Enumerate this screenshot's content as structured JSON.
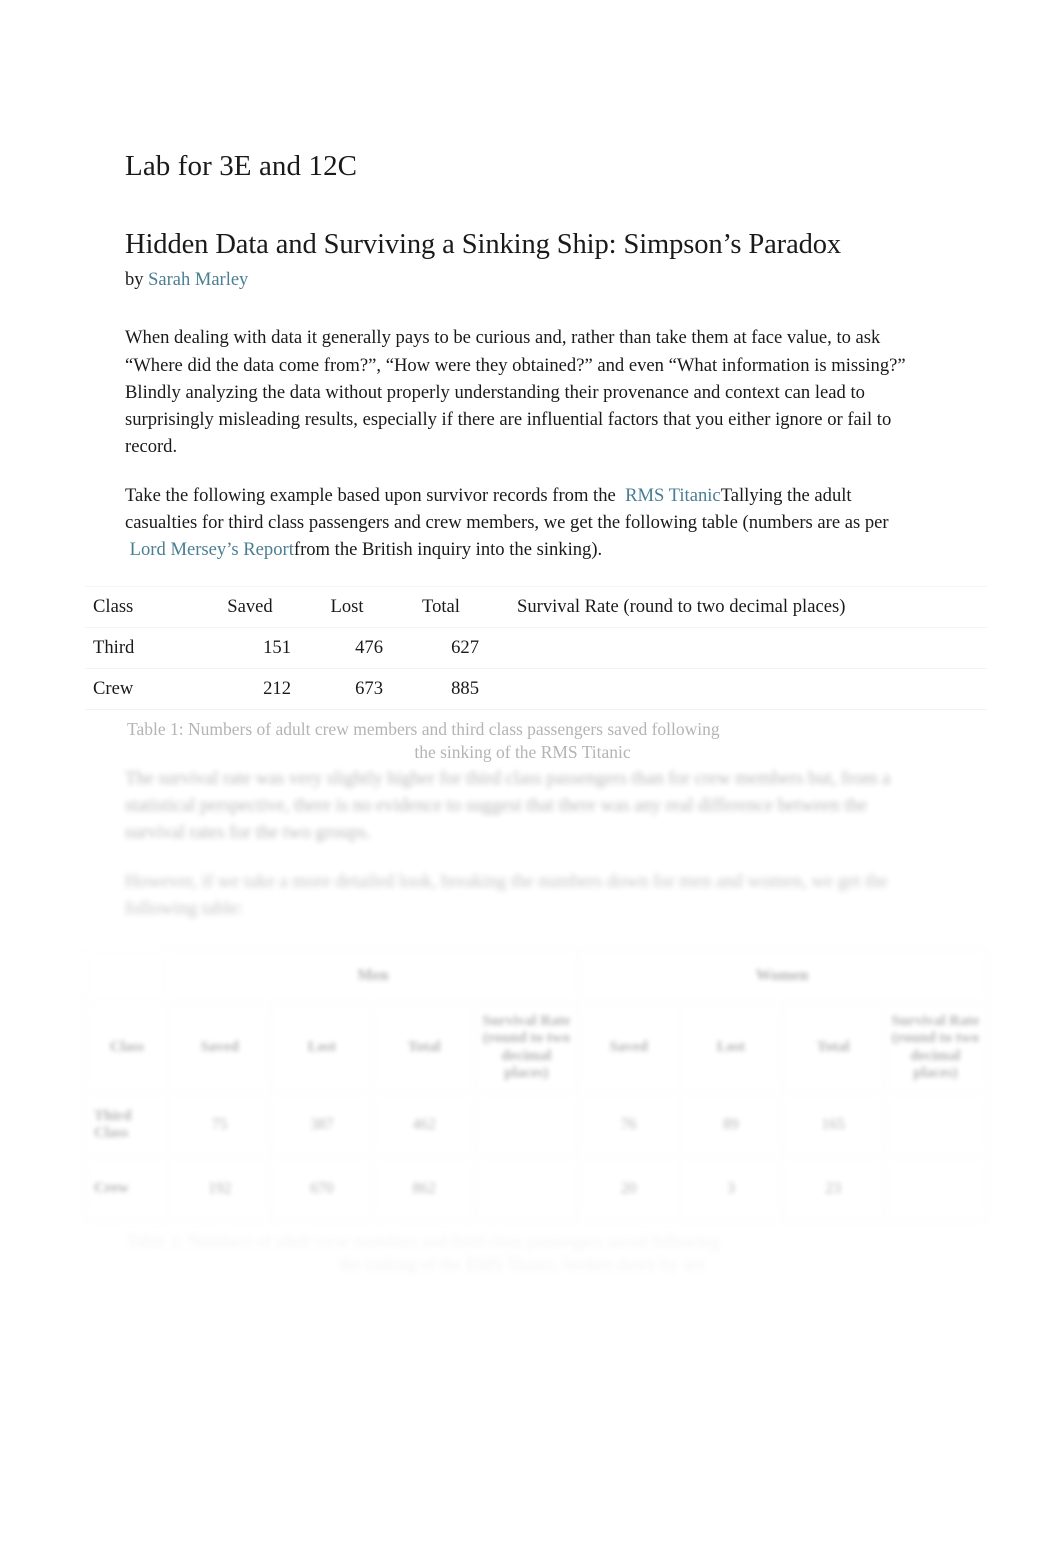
{
  "document": {
    "lab_title": "Lab for 3E and 12C",
    "article_title": "Hidden Data and Surviving a Sinking Ship: Simpson’s Paradox",
    "byline_prefix": "by",
    "author": "Sarah Marley"
  },
  "colors": {
    "link": "#4a7e92",
    "text": "#1a1a1a",
    "caption": "#b4b4b4",
    "background": "#ffffff",
    "table_rule": "#f2f2f2"
  },
  "paragraphs": {
    "intro": "When dealing with data it generally pays to be curious and, rather than take them at face value, to ask “Where did the data come from?”, “How were they obtained?” and even “What information is missing?” Blindly analyzing the data without properly understanding their provenance and context can lead to surprisingly misleading results, especially if there are influential factors that you either ignore or fail to record.",
    "example_part1": "Take the following example based upon survivor records from the",
    "example_link1": "RMS Titanic",
    "example_part2": "Tallying the adult casualties for third class passengers and crew members, we get the following table (numbers are as per",
    "example_link2": "Lord Mersey’s Report",
    "example_part3": "from the British inquiry into the sinking).",
    "faded_1": "The survival rate was very slightly higher for third class passengers than for crew members but, from a statistical perspective, there is no evidence to suggest that there was any real difference between the survival rates for the two groups.",
    "faded_2": "However, if we take a more detailed look, breaking the numbers down for men and women, we get the following table:"
  },
  "table1": {
    "headers": [
      "Class",
      "Saved",
      "Lost",
      "Total",
      "Survival Rate (round to two decimal places)"
    ],
    "rows": [
      {
        "class": "Third",
        "saved": "151",
        "lost": "476",
        "total": "627",
        "rate": ""
      },
      {
        "class": "Crew",
        "saved": "212",
        "lost": "673",
        "total": "885",
        "rate": ""
      }
    ],
    "caption_line1": "Table 1: Numbers of adult crew members and third class passengers saved following",
    "caption_line2": "the sinking of the RMS Titanic"
  },
  "table2": {
    "group_blank": "",
    "group_men": "Men",
    "group_women": "Women",
    "sub_headers": {
      "class": "Class",
      "saved": "Saved",
      "lost": "Lost",
      "total": "Total",
      "rate": "Survival Rate (round to two decimal places)"
    },
    "rows": [
      {
        "label": "Third Class",
        "men_saved": "75",
        "men_lost": "387",
        "men_total": "462",
        "men_rate": "",
        "women_saved": "76",
        "women_lost": "89",
        "women_total": "165",
        "women_rate": ""
      },
      {
        "label": "Crew",
        "men_saved": "192",
        "men_lost": "670",
        "men_total": "862",
        "men_rate": "",
        "women_saved": "20",
        "women_lost": "3",
        "women_total": "23",
        "women_rate": ""
      }
    ],
    "caption_line1": "Table 2: Numbers of adult crew members and third class passengers saved following",
    "caption_line2": "the sinking of the RMS Titanic, broken down by sex"
  }
}
